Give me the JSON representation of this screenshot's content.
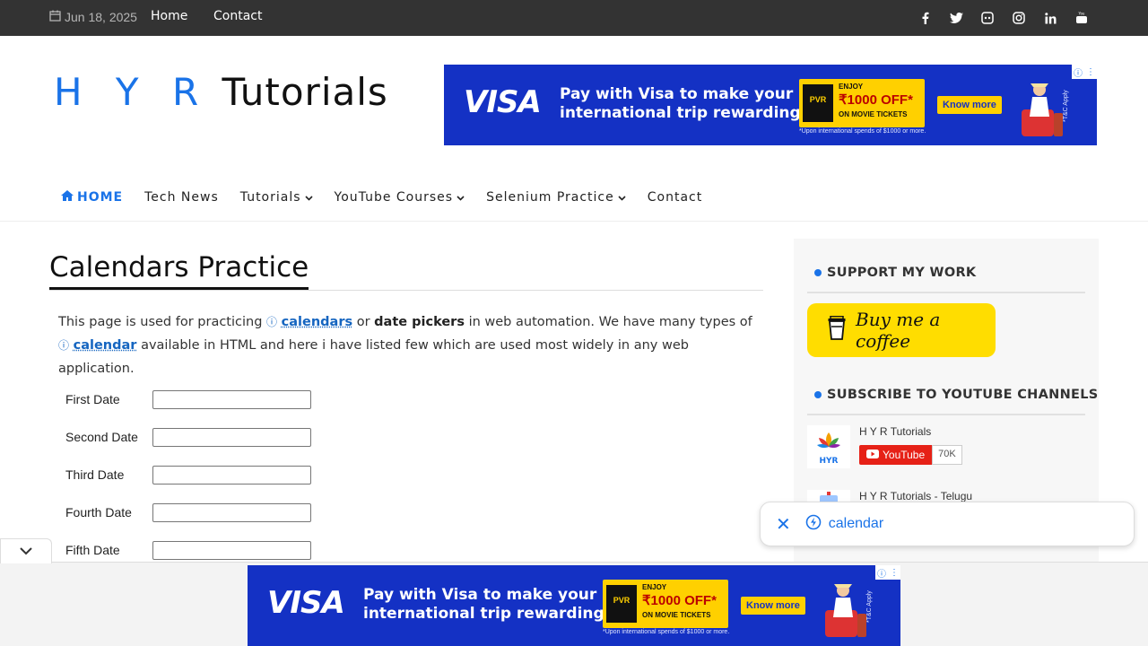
{
  "topbar": {
    "date": "Jun 18, 2025",
    "links": [
      "Home",
      "Contact"
    ],
    "social_icons": [
      "facebook-icon",
      "twitter-icon",
      "discord-icon",
      "instagram-icon",
      "linkedin-icon",
      "youtube-icon"
    ]
  },
  "header": {
    "logo_hyr": "H Y R",
    "logo_tutorials": "Tutorials"
  },
  "ad": {
    "brand": "VISA",
    "line1": "Pay with Visa to make your",
    "line2": "international trip rewarding!",
    "pvr_logo": "PVR",
    "enjoy": "ENJOY",
    "offer": "₹1000 OFF*",
    "offer_sub": "ON MOVIE TICKETS",
    "cta": "Know more",
    "fine_print": "*Upon international spends of $1000 or more.",
    "tc": "*T&C Apply"
  },
  "nav": {
    "items": [
      {
        "label": "HOME",
        "dropdown": false
      },
      {
        "label": "Tech News",
        "dropdown": false
      },
      {
        "label": "Tutorials",
        "dropdown": true
      },
      {
        "label": "YouTube Courses",
        "dropdown": true
      },
      {
        "label": "Selenium Practice",
        "dropdown": true
      },
      {
        "label": "Contact",
        "dropdown": false
      }
    ]
  },
  "main": {
    "title": "Calendars Practice",
    "intro_1": "This page is used for practicing",
    "link_calendars": "calendars",
    "intro_2": "or",
    "bold_date_pickers": "date pickers",
    "intro_3": "in web automation. We have many types of",
    "link_calendar": "calendar",
    "intro_4": "available in HTML and here i have listed few which are used most widely in any web application.",
    "fields": [
      {
        "label": "First Date",
        "value": ""
      },
      {
        "label": "Second Date",
        "value": ""
      },
      {
        "label": "Third Date",
        "value": ""
      },
      {
        "label": "Fourth Date",
        "value": ""
      },
      {
        "label": "Fifth Date",
        "value": ""
      }
    ]
  },
  "sidebar": {
    "support_heading": "SUPPORT MY WORK",
    "coffee_label": "Buy me a coffee",
    "subscribe_heading": "SUBSCRIBE TO YOUTUBE CHANNELS",
    "channels": [
      {
        "name": "H Y R Tutorials",
        "button": "YouTube",
        "count": "70K",
        "thumb": "HYR"
      },
      {
        "name": "H Y R Tutorials - Telugu"
      }
    ]
  },
  "search_chip": {
    "term": "calendar"
  },
  "colors": {
    "accent": "#1a73e8",
    "topbar": "#333333",
    "ad_blue": "#1431c4",
    "coffee_yellow": "#ffdd00",
    "youtube_red": "#e62117"
  }
}
